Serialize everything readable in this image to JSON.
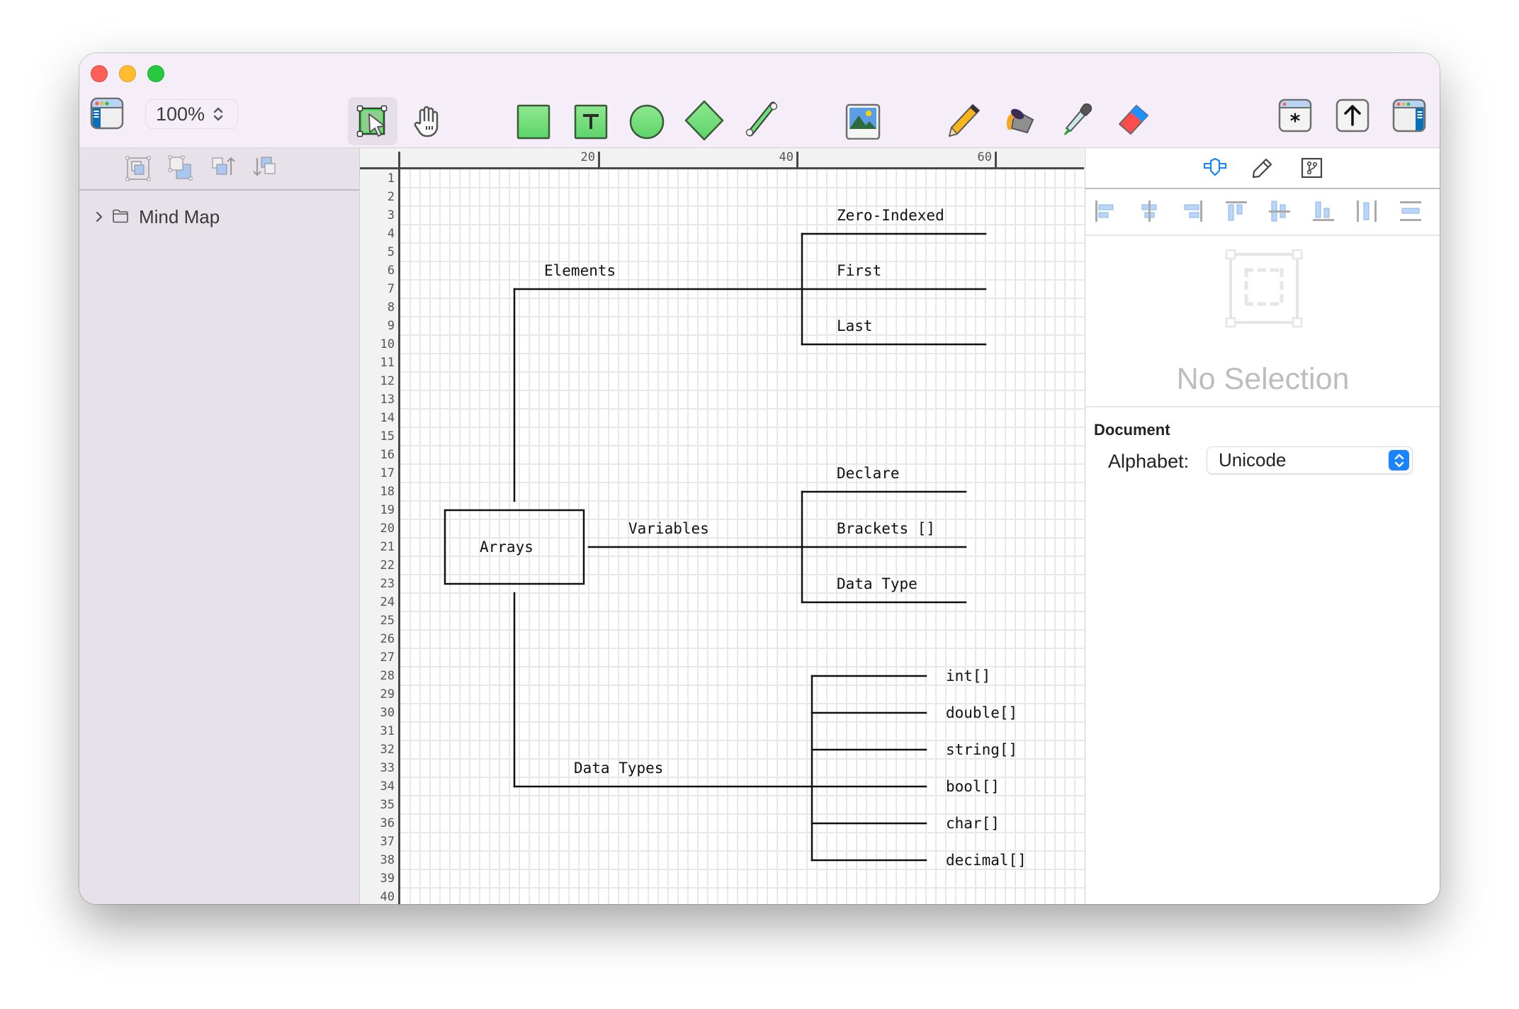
{
  "window": {
    "title": "Mind Map"
  },
  "toolbar": {
    "zoom_value": "100%",
    "tools": [
      {
        "name": "select-tool",
        "icon": "select-arrow-icon",
        "selected": true
      },
      {
        "name": "hand-tool",
        "icon": "hand-icon"
      },
      {
        "name": "rectangle-tool",
        "icon": "rectangle-icon"
      },
      {
        "name": "text-tool",
        "icon": "text-box-icon",
        "glyph": "T"
      },
      {
        "name": "ellipse-tool",
        "icon": "ellipse-icon"
      },
      {
        "name": "diamond-tool",
        "icon": "diamond-icon"
      },
      {
        "name": "line-tool",
        "icon": "line-icon"
      },
      {
        "name": "image-tool",
        "icon": "image-icon"
      },
      {
        "name": "pencil-tool",
        "icon": "pencil-icon"
      },
      {
        "name": "paint-bucket-tool",
        "icon": "paint-bucket-icon"
      },
      {
        "name": "eyedropper-tool",
        "icon": "eyedropper-icon"
      },
      {
        "name": "eraser-tool",
        "icon": "eraser-icon"
      }
    ],
    "right_buttons": [
      {
        "name": "character-palette-button",
        "icon": "asterisk-window-icon",
        "glyph": "*"
      },
      {
        "name": "share-button",
        "icon": "share-up-arrow-icon",
        "glyph": "↑"
      },
      {
        "name": "toggle-inspector-button",
        "icon": "inspector-window-icon"
      }
    ]
  },
  "sidebar": {
    "tools": [
      "group-icon",
      "ungroup-icon",
      "bring-forward-icon",
      "send-backward-icon"
    ],
    "tree": [
      {
        "label": "Mind Map",
        "expanded": false,
        "icon": "folder-icon"
      }
    ]
  },
  "canvas": {
    "ruler_labels": [
      "20",
      "40",
      "60"
    ],
    "row_count": 40,
    "diagram": {
      "root": "Arrays",
      "branches": [
        {
          "label": "Elements",
          "children": [
            "Zero-Indexed",
            "First",
            "Last"
          ]
        },
        {
          "label": "Variables",
          "children": [
            "Declare",
            "Brackets []",
            "Data Type"
          ]
        },
        {
          "label": "Data Types",
          "children": [
            "int[]",
            "double[]",
            "string[]",
            "bool[]",
            "char[]",
            "decimal[]"
          ]
        }
      ]
    }
  },
  "inspector": {
    "tabs": [
      {
        "name": "tab-shape",
        "icon": "shape-connector-icon",
        "active": true
      },
      {
        "name": "tab-style",
        "icon": "pencil-icon"
      },
      {
        "name": "tab-connection",
        "icon": "branch-icon"
      }
    ],
    "align_buttons": [
      "align-left-icon",
      "align-center-horizontal-icon",
      "align-right-icon",
      "align-top-icon",
      "align-center-vertical-icon",
      "align-bottom-icon",
      "distribute-horizontal-icon",
      "distribute-vertical-icon"
    ],
    "no_selection_text": "No Selection",
    "document_heading": "Document",
    "alphabet_label": "Alphabet:",
    "alphabet_value": "Unicode"
  },
  "colors": {
    "accent": "#1a84ff",
    "toolbar_bg": "#f5eef8",
    "sidebar_bg": "#e7e2ea",
    "shape_green": "#6ddf78"
  }
}
